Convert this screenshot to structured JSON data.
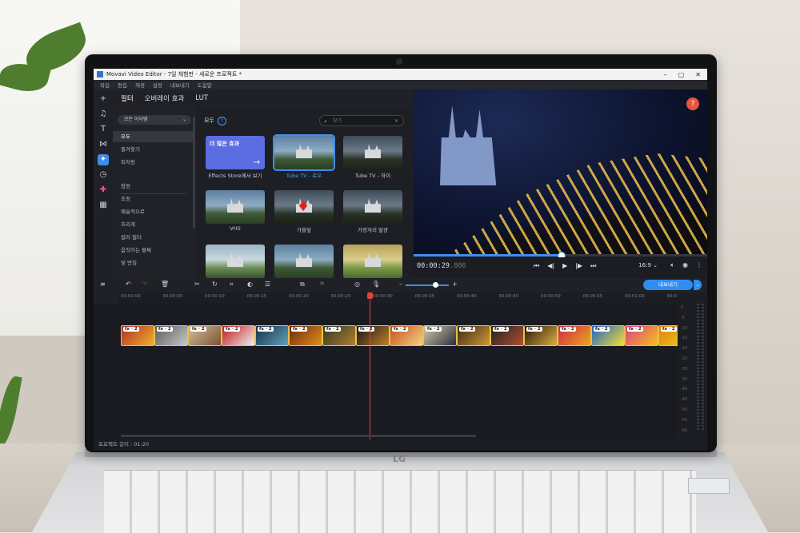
{
  "window": {
    "title": "Movavi Video Editor - 7일 체험판 - 새로운 프로젝트 *",
    "controls": [
      "–",
      "▢",
      "✕"
    ]
  },
  "menu": [
    "파일",
    "편집",
    "재생",
    "설정",
    "내보내기",
    "도움말"
  ],
  "effect_tabs": [
    "필터",
    "오버레이 효과",
    "LUT"
  ],
  "side_panel": {
    "dropdown": "모든 아이템",
    "items_top": [
      "모두",
      "즐겨찾기",
      "피처링"
    ],
    "items_bottom": [
      "참원",
      "조정",
      "예술적으로",
      "흐리게",
      "컬러 필터",
      "움직이는 물체",
      "빛 번짐"
    ]
  },
  "grid": {
    "heading": "모두",
    "search_placeholder": "찾기",
    "more_effects_title": "더 많은 효과",
    "tiles": [
      "Effects Store에서 보기",
      "Tube TV - 로우",
      "Tube TV - 하이",
      "VHS",
      "가을잎",
      "가장자리 발광"
    ]
  },
  "preview": {
    "help": "?",
    "timecode_main": "00:00:29",
    "timecode_ms": ".800",
    "progress": 0.5,
    "aspect_ratio": "16:9"
  },
  "timeline": {
    "export_label": "내보내기",
    "ruler": [
      "00:00:00",
      "00:00:05",
      "00:00:10",
      "00:00:15",
      "00:00:20",
      "00:00:25",
      "00:00:30",
      "00:00:35",
      "00:00:40",
      "00:00:45",
      "00:00:50",
      "00:00:55",
      "00:01:00",
      "00:01:05"
    ],
    "clip_badge": "fx · 2",
    "clip_count": 17,
    "meter_labels": [
      "0",
      "-5",
      "-10",
      "-15",
      "-20",
      "-25",
      "-30",
      "-35",
      "-40",
      "-45",
      "-50",
      "-55",
      "-60"
    ]
  },
  "status": {
    "project_length": "프로젝트 길이 : 01:20"
  },
  "laptop": {
    "brand": "LG"
  }
}
